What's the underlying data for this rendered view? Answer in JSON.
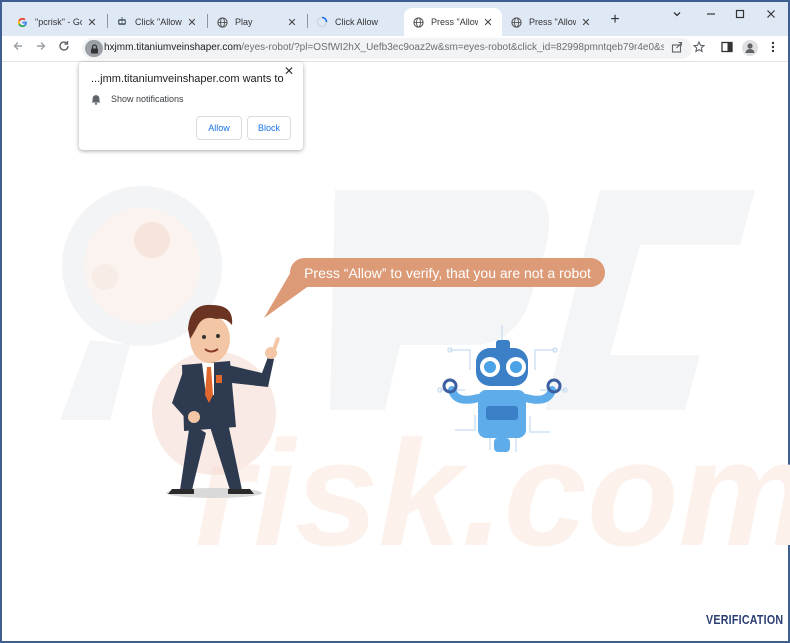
{
  "tabs": [
    {
      "label": "\"pcrisk\" - Goo",
      "icon": "google-icon",
      "active": false
    },
    {
      "label": "Click \"Allow\"",
      "icon": "robot-favicon",
      "active": false
    },
    {
      "label": "Play",
      "icon": "globe-icon",
      "active": false
    },
    {
      "label": "Click Allow",
      "icon": "loading-icon",
      "active": false
    },
    {
      "label": "Press \"Allow\"",
      "icon": "globe-icon",
      "active": true
    },
    {
      "label": "Press \"Allow\"",
      "icon": "globe-icon",
      "active": false
    }
  ],
  "address_bar": {
    "domain": "hxjmm.titaniumveinshaper.com",
    "path": "/eyes-robot/?pl=OSfWI2hX_Uefb3ec9oaz2w&sm=eyes-robot&click_id=82998pmntqeb79r4e0&s..."
  },
  "popup": {
    "title": "...jmm.titaniumveinshaper.com wants to",
    "permission": "Show notifications",
    "allow_label": "Allow",
    "block_label": "Block",
    "close_symbol": "✕"
  },
  "page": {
    "bubble_text": "Press “Allow” to verify, that you are not a robot",
    "footer_logo": "VERIFICATION"
  },
  "colors": {
    "tabstrip": "#dfe8f5",
    "bubble": "#dc9a76",
    "button_text": "#1a73e8",
    "logo": "#2a3f73"
  }
}
